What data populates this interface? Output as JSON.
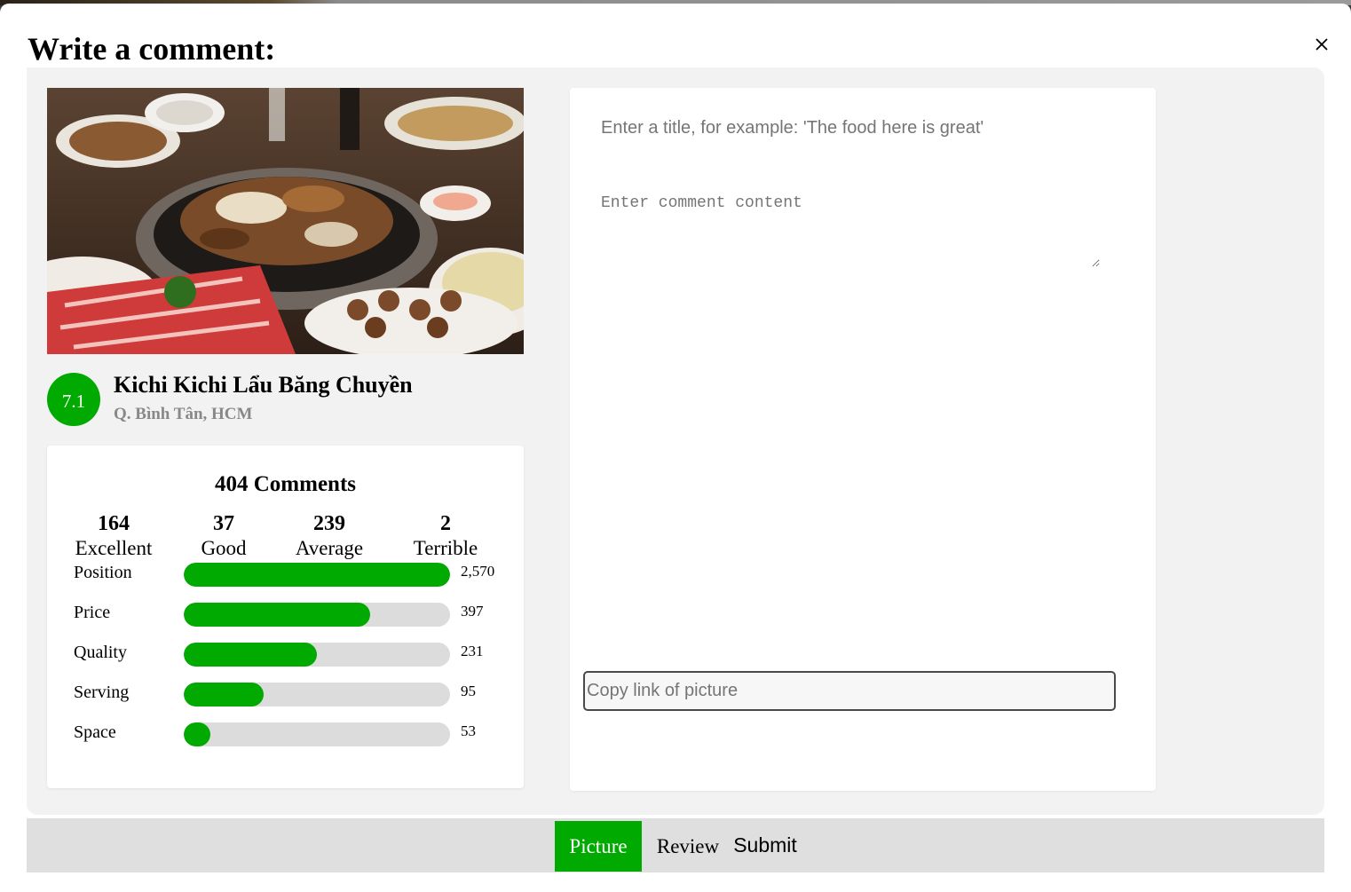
{
  "modal": {
    "title": "Write a comment:",
    "close_icon": "close-icon"
  },
  "restaurant": {
    "photo_icon": "food-hotpot-photo",
    "score": "7.1",
    "name": "Kichi Kichi Lẩu Băng Chuyền",
    "location": "Q. Bình Tân, HCM"
  },
  "stats": {
    "heading": "404 Comments",
    "ratings": [
      {
        "count": "164",
        "label": "Excellent"
      },
      {
        "count": "37",
        "label": "Good"
      },
      {
        "count": "239",
        "label": "Average"
      },
      {
        "count": "2",
        "label": "Terrible"
      }
    ],
    "criteria": [
      {
        "label": "Position",
        "value": "2,570",
        "fill_fraction": 1.0
      },
      {
        "label": "Price",
        "value": "397",
        "fill_fraction": 0.7
      },
      {
        "label": "Quality",
        "value": "231",
        "fill_fraction": 0.5
      },
      {
        "label": "Serving",
        "value": "95",
        "fill_fraction": 0.3
      },
      {
        "label": "Space",
        "value": "53",
        "fill_fraction": 0.1
      }
    ]
  },
  "form": {
    "title_placeholder": "Enter a title, for example: 'The food here is great'",
    "title_value": "",
    "content_placeholder": "Enter comment content",
    "content_value": "",
    "picture_link_placeholder": "Copy link of picture",
    "picture_link_value": ""
  },
  "footer": {
    "picture_tab": "Picture",
    "review_tab": "Review",
    "submit_label": "Submit"
  },
  "colors": {
    "accent": "#00aa00",
    "panel_bg": "#f2f2f2",
    "track_bg": "#dcdcdc",
    "footer_bg": "#dfdfdf",
    "muted_text": "#888888"
  }
}
